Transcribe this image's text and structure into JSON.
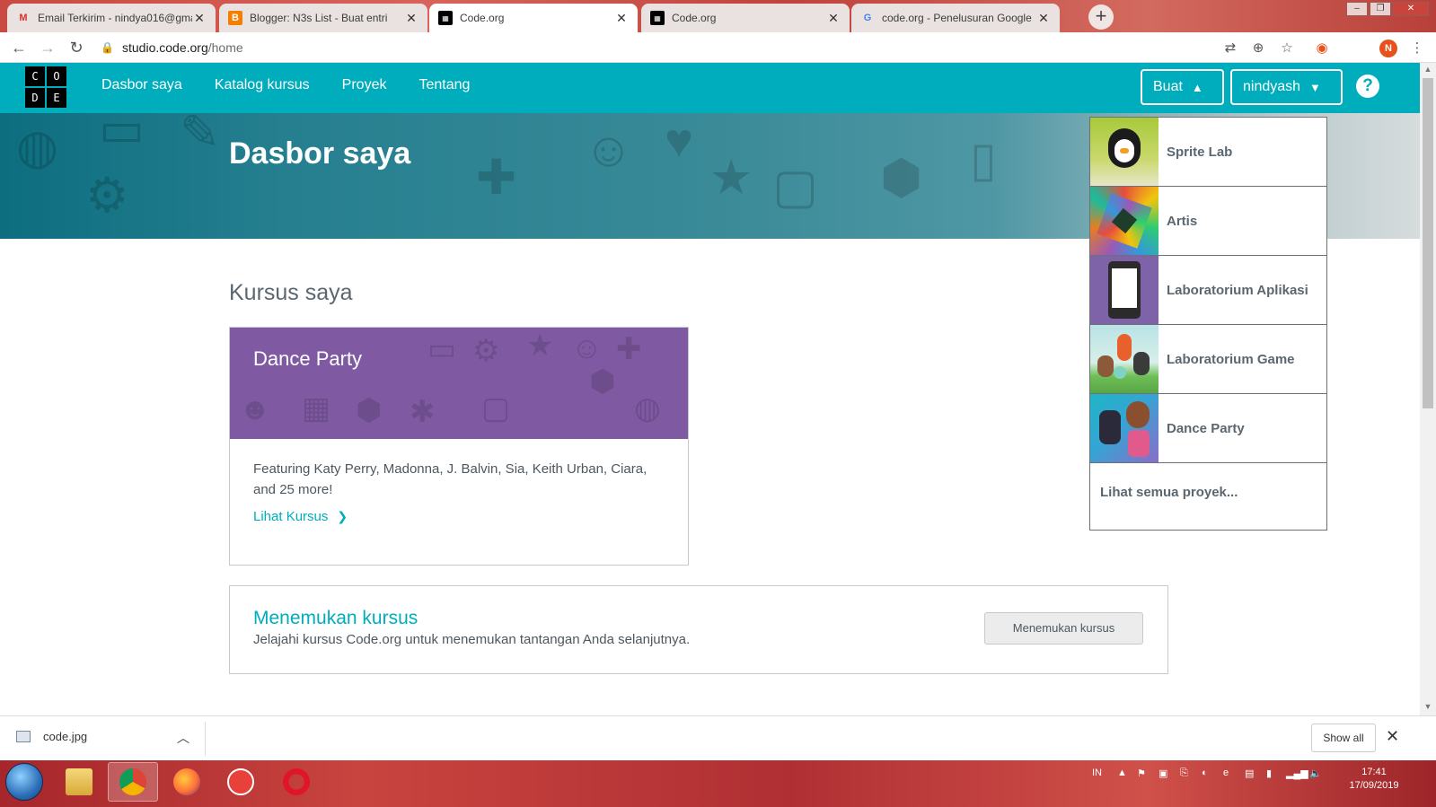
{
  "browser": {
    "tabs": [
      {
        "title": "Email Terkirim - nindya016@gma",
        "favicon": "gmail-icon",
        "active": false
      },
      {
        "title": "Blogger: N3s List - Buat entri",
        "favicon": "blogger-icon",
        "active": false
      },
      {
        "title": "Code.org",
        "favicon": "codeorg-icon",
        "active": true
      },
      {
        "title": "Code.org",
        "favicon": "codeorg-icon",
        "active": false
      },
      {
        "title": "code.org - Penelusuran Google",
        "favicon": "google-icon",
        "active": false
      }
    ],
    "url_host": "studio.code.org",
    "url_path": "/home",
    "profile_initial": "N"
  },
  "header": {
    "logo_letters": [
      "C",
      "O",
      "D",
      "E"
    ],
    "nav": [
      "Dasbor saya",
      "Katalog kursus",
      "Proyek",
      "Tentang"
    ],
    "create_label": "Buat",
    "user_label": "nindyash",
    "help_glyph": "?"
  },
  "banner": {
    "title": "Dasbor saya"
  },
  "courses": {
    "section_title": "Kursus saya",
    "card": {
      "title": "Dance Party",
      "description": "Featuring Katy Perry, Madonna, J. Balvin, Sia, Keith Urban, Ciara, and 25 more!",
      "link": "Lihat Kursus"
    }
  },
  "discover": {
    "title": "Menemukan kursus",
    "description": "Jelajahi kursus Code.org untuk menemukan tantangan Anda selanjutnya.",
    "button": "Menemukan kursus"
  },
  "create_menu": {
    "items": [
      {
        "label": "Sprite Lab"
      },
      {
        "label": "Artis"
      },
      {
        "label": "Laboratorium Aplikasi"
      },
      {
        "label": "Laboratorium Game"
      },
      {
        "label": "Dance Party"
      }
    ],
    "view_all": "Lihat semua proyek..."
  },
  "downloads": {
    "file": "code.jpg",
    "show_all": "Show all"
  },
  "taskbar": {
    "lang": "IN",
    "time": "17:41",
    "date": "17/09/2019"
  },
  "colors": {
    "brand_teal": "#00adbc",
    "course_purple": "#7f5aa3",
    "text_gray": "#5b6770"
  }
}
